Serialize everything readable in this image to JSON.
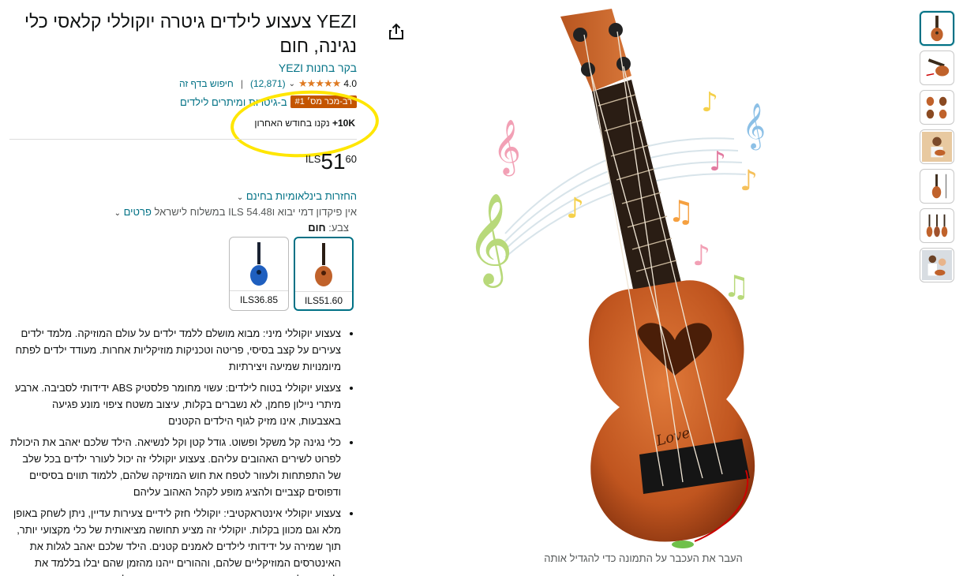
{
  "product": {
    "title": "YEZI צעצוע לילדים גיטרה יוקוללי קלאסי כלי נגינה, חום",
    "brand_link": "בקר בחנות YEZI",
    "rating": "4.0",
    "stars": "★★★★★",
    "review_count": "(12,871)",
    "search_link": "חיפוש בדף זה",
    "badge": "רב-מכר מס׳ #1",
    "badge_category": "ב-גיטרות ומיתרים לילדים",
    "bought_count": "10K+",
    "bought_text": " נקנו בחודש האחרון",
    "price_currency": "ILS",
    "price_whole": "51",
    "price_fraction": "60",
    "returns": "החזרות בינלאומיות בחינם",
    "shipping_text": "אין פיקדון דמי יבוא ו‎ILS 54.48‎ במשלוח לישראל",
    "shipping_details": "פרטים",
    "color_label": "צבע: ",
    "color_value": "חום"
  },
  "swatches": [
    {
      "price": "ILS51.60",
      "color": "#c0622b"
    },
    {
      "price": "ILS36.85",
      "color": "#1f5fbf"
    }
  ],
  "image_caption": "העבר את העכבר על התמונה כדי להגדיל אותה",
  "bullets": [
    "צעצוע יוקוללי מיני: מבוא מושלם ללמד ילדים על עולם המוזיקה. מלמד ילדים צעירים על קצב בסיסי, פריטה וטכניקות מוזיקליות אחרות. מעודד ילדים לפתח מיומנויות שמיעה ויצירתיות",
    "צעצוע יוקוללי בטוח לילדים: עשוי מחומר פלסטיק ABS ידידותי לסביבה. ארבע מיתרי ניילון פחמן, לא נשברים בקלות, עיצוב משטח ציפוי מונע פגיעה באצבעות, אינו מזיק לגוף הילדים הקטנים",
    "כלי נגינה קל משקל ופשוט. גודל קטן וקל לנשיאה. הילד שלכם יאהב את היכולת לפרוט לשירים האהובים עליהם. צעצוע יוקוללי זה יכול לעורר ילדים בכל שלב של התפתחות ולעזור לטפח את חוש המוזיקה שלהם, ללמוד תווים בסיסיים ודפוסים קצביים ולהציג מופע לקהל האהוב עליהם",
    "צעצוע יוקוללי אינטראקטיבי: יוקוללי חזק לידיים צעירות עדיין, ניתן לשחק באופן מלא וגם מכוון בקלות. יוקוללי זה מציע תחושה מציאותית של כלי מקצועי יותר, תוך שמירה על ידידותי לילדים לאמנים קטנים. הילד שלכם יאהב לגלות את האינטרסים המוזיקליים שלהם, וההורים ייהנו מהזמן שהם יבלו בללמד את ילדיהם על קצב, קומפוזיציה, פריטה וטכניקות מוזיקליות אחרות"
  ],
  "colors": {
    "link": "#007185",
    "badge": "#c45500",
    "highlight": "#ffe600",
    "star": "#de7921"
  }
}
